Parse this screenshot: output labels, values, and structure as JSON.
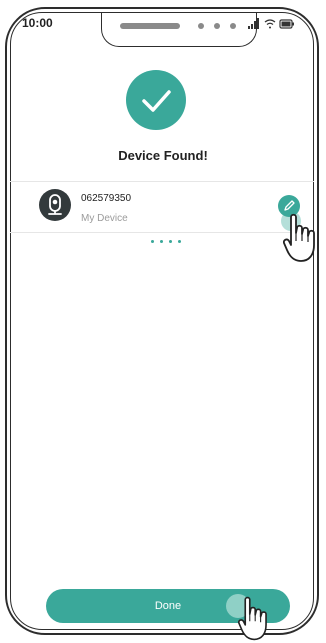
{
  "status_bar": {
    "time": "10:00",
    "icons": [
      "signal-icon",
      "wifi-icon",
      "battery-icon"
    ]
  },
  "header": {
    "icon": "check-icon",
    "title": "Device Found!"
  },
  "device": {
    "id": "062579350",
    "name": "My Device",
    "icon": "camera-icon",
    "edit_icon": "pencil-icon"
  },
  "footer": {
    "done_label": "Done"
  },
  "colors": {
    "accent": "#3aa89a",
    "accent_light": "#a7d9d2",
    "avatar_bg": "#333a3c",
    "frame": "#2d2d2d"
  }
}
